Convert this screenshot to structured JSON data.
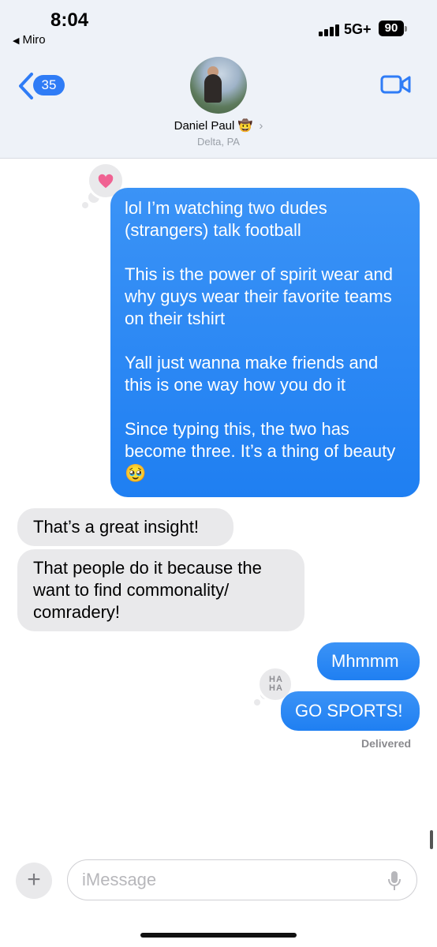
{
  "status_bar": {
    "time": "8:04",
    "back_app": "Miro",
    "network": "5G+",
    "battery": "90"
  },
  "header": {
    "unread_count": "35",
    "contact_name": "Daniel Paul",
    "contact_emoji": "🤠",
    "contact_location": "Delta, PA"
  },
  "messages": [
    {
      "direction": "outgoing",
      "tapback": "heart",
      "paragraphs": [
        "lol I’m watching two dudes (strangers) talk football",
        "This is the power of spirit wear and why guys wear their favorite teams on their tshirt",
        "Yall just wanna make friends and this is one way how you do it",
        "Since typing this, the two has become three. It’s a thing of beauty 🥹"
      ]
    },
    {
      "direction": "incoming",
      "text": "That’s a great insight!"
    },
    {
      "direction": "incoming",
      "text": "That people do it because the want to find commonality/ comradery!"
    },
    {
      "direction": "outgoing",
      "text": "Mhmmm"
    },
    {
      "direction": "outgoing",
      "tapback": "haha",
      "tapback_text": "HA HA",
      "text": "GO SPORTS!"
    }
  ],
  "delivered_label": "Delivered",
  "composer": {
    "placeholder": "iMessage"
  },
  "colors": {
    "outgoing_bubble": "#1f7ff2",
    "incoming_bubble": "#e9e9eb",
    "header_bg": "#eef2f8",
    "heart": "#f06292"
  }
}
